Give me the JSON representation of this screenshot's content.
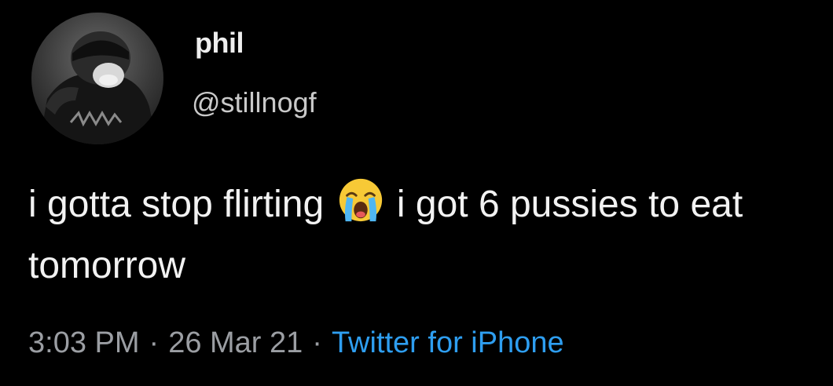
{
  "author": {
    "display_name": "phil",
    "handle": "@stillnogf",
    "avatar_icon": "profile-photo"
  },
  "tweet": {
    "text_before_emoji": "i gotta stop flirting",
    "emoji_icon": "loudly-crying-face-emoji",
    "text_after_emoji": "i got 6 pussies to eat tomorrow"
  },
  "meta": {
    "time": "3:03 PM",
    "separator": "·",
    "date": "26 Mar 21",
    "source": "Twitter for iPhone"
  },
  "colors": {
    "background": "#000000",
    "text": "#f2f2f2",
    "secondary_text": "#9b9ea3",
    "link": "#2e9ef0"
  }
}
